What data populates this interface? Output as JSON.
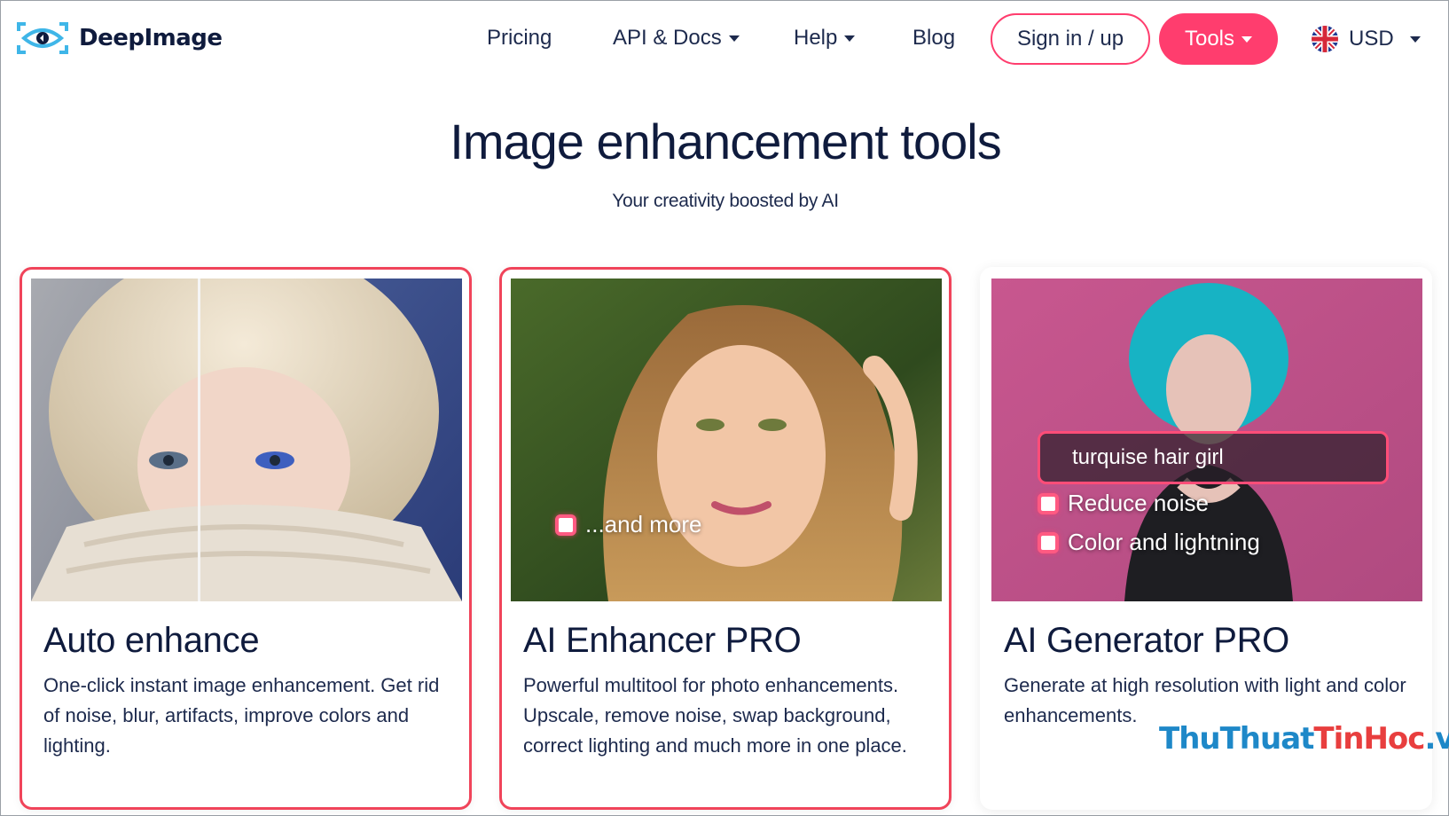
{
  "brand": {
    "name": "DeepImage",
    "accent": "#ff3d6e"
  },
  "nav": {
    "pricing": "Pricing",
    "api_docs": "API & Docs",
    "help": "Help",
    "blog": "Blog",
    "signin": "Sign in / up",
    "tools": "Tools",
    "currency": "USD",
    "currency_flag_icon": "uk-flag-icon"
  },
  "hero": {
    "title": "Image enhancement tools",
    "subtitle": "Your creativity boosted by AI"
  },
  "cards": [
    {
      "title": "Auto enhance",
      "description": "One-click instant image enhancement. Get rid of noise, blur, artifacts, improve colors and lighting.",
      "selected": true
    },
    {
      "title": "AI Enhancer PRO",
      "description": "Powerful multitool for photo enhancements. Upscale, remove noise, swap background, correct lighting and much more in one place.",
      "overlay": "...and more",
      "selected": true
    },
    {
      "title": "AI Generator PRO",
      "description": "Generate at high resolution with light and color enhancements.",
      "prompt": "turquise hair girl",
      "options": [
        "Reduce noise",
        "Color and lightning"
      ],
      "selected": false
    }
  ],
  "watermark": {
    "part1": "ThuThuat",
    "part2": "TinHoc",
    "part3": ".vn"
  }
}
